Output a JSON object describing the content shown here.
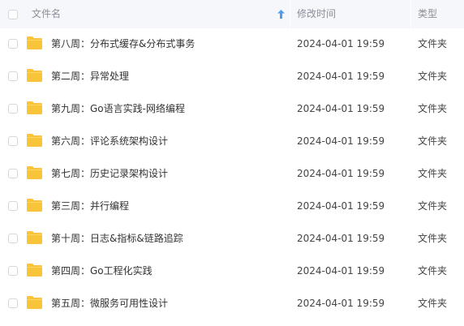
{
  "header": {
    "name_label": "文件名",
    "modified_label": "修改时间",
    "type_label": "类型",
    "sort_icon": "sort-ascending-arrow"
  },
  "colors": {
    "header_bg": "#f6f7fa",
    "folder": "#f9c43a",
    "sort_arrow": "#4c9cf0"
  },
  "files": [
    {
      "name": "第八周：分布式缓存&分布式事务",
      "modified": "2024-04-01 19:59",
      "type": "文件夹"
    },
    {
      "name": "第二周：异常处理",
      "modified": "2024-04-01 19:59",
      "type": "文件夹"
    },
    {
      "name": "第九周：Go语言实践-网络编程",
      "modified": "2024-04-01 19:59",
      "type": "文件夹"
    },
    {
      "name": "第六周：评论系统架构设计",
      "modified": "2024-04-01 19:59",
      "type": "文件夹"
    },
    {
      "name": "第七周：历史记录架构设计",
      "modified": "2024-04-01 19:59",
      "type": "文件夹"
    },
    {
      "name": "第三周：并行编程",
      "modified": "2024-04-01 19:59",
      "type": "文件夹"
    },
    {
      "name": "第十周：日志&指标&链路追踪",
      "modified": "2024-04-01 19:59",
      "type": "文件夹"
    },
    {
      "name": "第四周：Go工程化实践",
      "modified": "2024-04-01 19:59",
      "type": "文件夹"
    },
    {
      "name": "第五周：微服务可用性设计",
      "modified": "2024-04-01 19:59",
      "type": "文件夹"
    }
  ]
}
